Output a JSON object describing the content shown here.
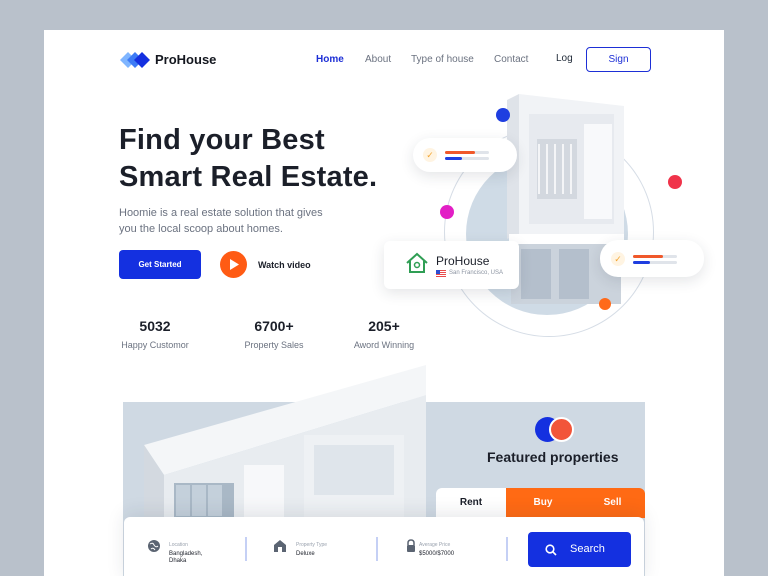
{
  "brand": {
    "name": "ProHouse"
  },
  "nav": {
    "items": [
      {
        "label": "Home",
        "active": true
      },
      {
        "label": "About",
        "active": false
      },
      {
        "label": "Type of house",
        "active": false
      },
      {
        "label": "Contact",
        "active": false
      }
    ],
    "login_label": "Log",
    "signup_label": "Sign"
  },
  "hero": {
    "title_line1": "Find your Best",
    "title_line2": "Smart Real Estate.",
    "description": "Hoomie is a real estate solution that gives you the local scoop about homes.",
    "cta_label": "Get Started",
    "video_label": "Watch video"
  },
  "stats": [
    {
      "value": "5032",
      "label": "Happy Customor"
    },
    {
      "value": "6700+",
      "label": "Property Sales"
    },
    {
      "value": "205+",
      "label": "Aword Winning"
    }
  ],
  "property_card": {
    "name": "ProHouse",
    "location": "San Francisco, USA"
  },
  "featured": {
    "title": "Featured properties",
    "tabs": [
      "Rent",
      "Buy",
      "Sell"
    ],
    "active_tab": "Rent"
  },
  "search": {
    "fields": [
      {
        "label": "Location",
        "value": "Bangladesh, Dhaka",
        "icon": "globe-icon"
      },
      {
        "label": "Property Type",
        "value": "Deluxe",
        "icon": "home-icon"
      },
      {
        "label": "Average Price",
        "value": "$5000/$7000",
        "icon": "lock-icon"
      }
    ],
    "button_label": "Search"
  },
  "colors": {
    "primary": "#1430e0",
    "accent": "#ff5b14",
    "text": "#1b1f29",
    "muted": "#6b7280"
  }
}
